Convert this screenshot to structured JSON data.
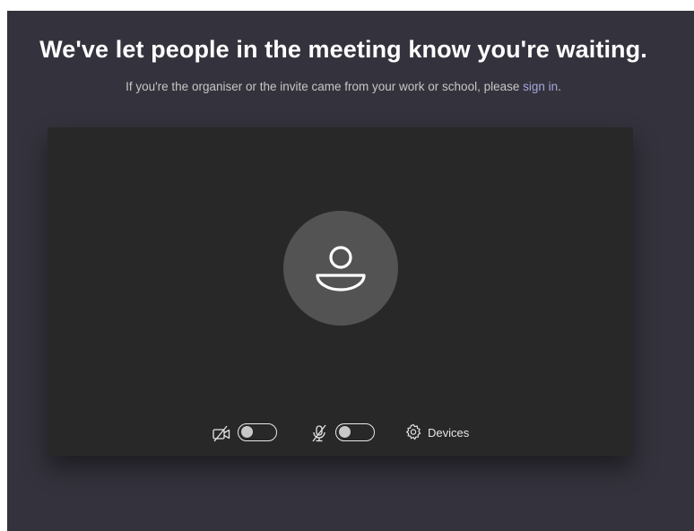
{
  "header": {
    "title": "We've let people in the meeting know you're waiting.",
    "subtitle_prefix": "If you're the organiser or the invite came from your work or school, please ",
    "sign_in_label": "sign in",
    "subtitle_suffix": "."
  },
  "preview": {
    "avatar_icon": "person-icon",
    "controls": {
      "camera": {
        "icon": "camera-off-icon",
        "on": false
      },
      "microphone": {
        "icon": "mic-off-icon",
        "on": false
      },
      "devices": {
        "icon": "gear-icon",
        "label": "Devices"
      }
    }
  },
  "colors": {
    "background": "#34333d",
    "preview_background": "#292829",
    "avatar_background": "#545353",
    "link": "#a6a7dc"
  }
}
